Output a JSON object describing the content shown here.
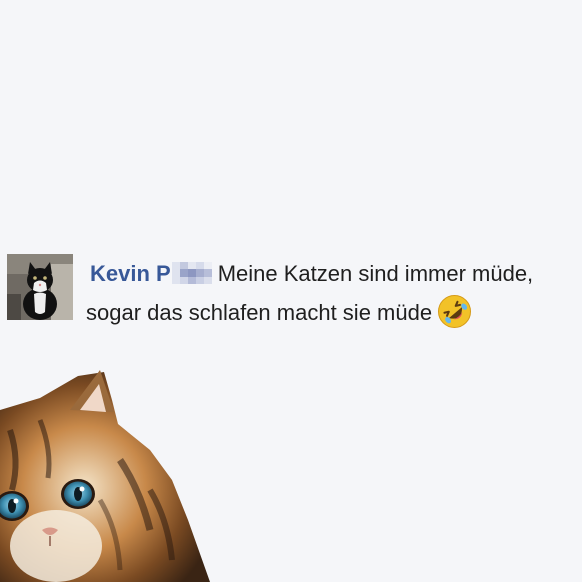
{
  "comment": {
    "author": "Kevin P",
    "text_line1": "Meine Katzen sind immer müde,",
    "text_line2": "sogar das schlafen macht sie müde",
    "emoji": "rolling-on-floor-laughing"
  },
  "colors": {
    "background": "#f5f6f9",
    "author_link": "#385898",
    "text": "#1f1f1f"
  }
}
